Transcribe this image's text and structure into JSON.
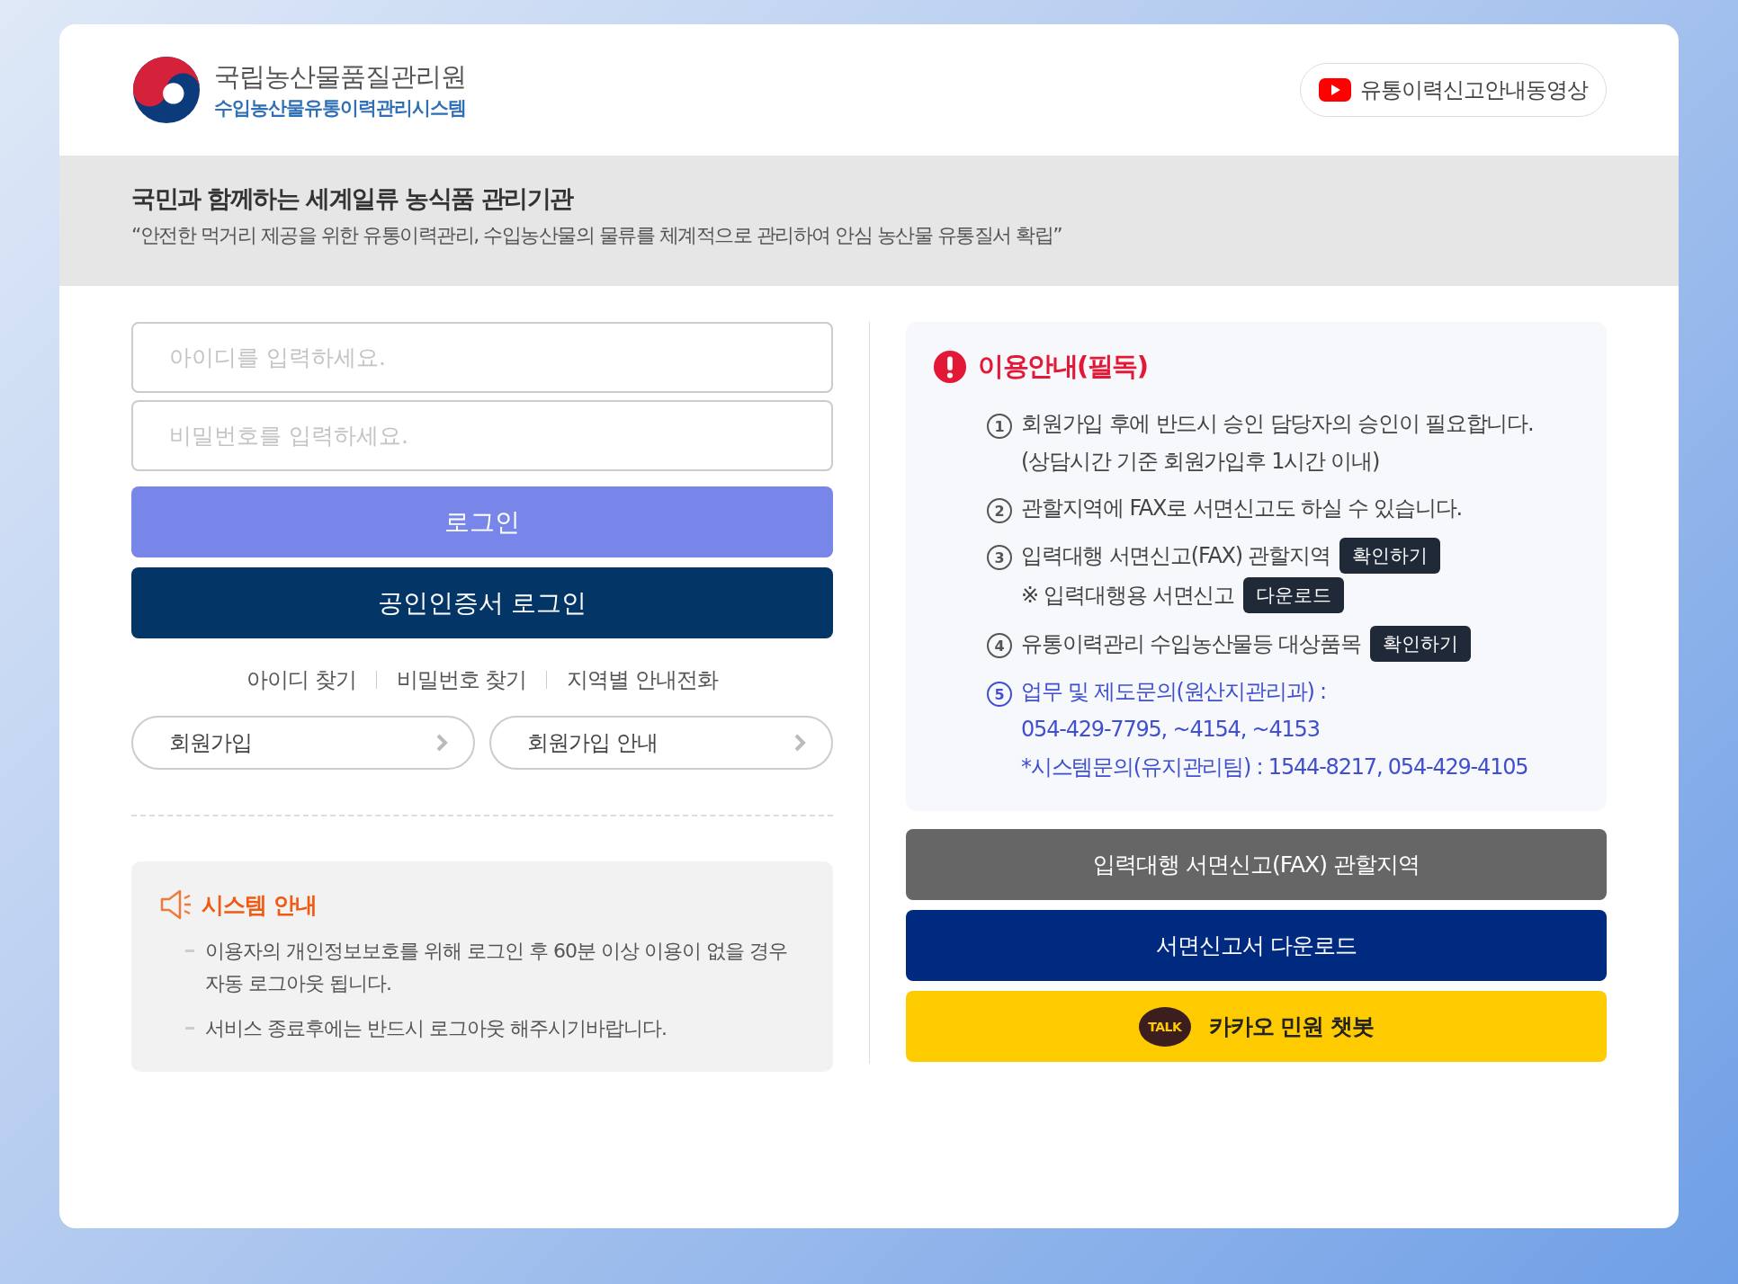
{
  "header": {
    "org_name": "국립농산물품질관리원",
    "system_name": "수입농산물유통이력관리시스템",
    "video_button": "유통이력신고안내동영상"
  },
  "banner": {
    "title": "국민과 함께하는 세계일류 농식품 관리기관",
    "quote": "“안전한 먹거리 제공을 위한 유통이력관리, 수입농산물의 물류를 체계적으로 관리하여 안심 농산물 유통질서 확립”"
  },
  "login": {
    "id_placeholder": "아이디를 입력하세요.",
    "pw_placeholder": "비밀번호를 입력하세요.",
    "login_button": "로그인",
    "cert_login_button": "공인인증서 로그인",
    "links": [
      "아이디 찾기",
      "비밀번호 찾기",
      "지역별 안내전화"
    ],
    "join_buttons": [
      "회원가입",
      "회원가입 안내"
    ]
  },
  "system_notice": {
    "title": "시스템 안내",
    "items": [
      "이용자의 개인정보보호를 위해 로그인 후 60분 이상 이용이 없을 경우 자동 로그아웃 됩니다.",
      "서비스 종료후에는 반드시 로그아웃 해주시기바랍니다."
    ]
  },
  "usage_guide": {
    "title": "이용안내(필독)",
    "items": [
      {
        "number": "1",
        "kind": "normal",
        "lines": [
          {
            "text": "회원가입 후에 반드시 승인 담당자의 승인이 필요합니다."
          },
          {
            "text": "(상담시간 기준 회원가입후 1시간 이내)"
          }
        ]
      },
      {
        "number": "2",
        "kind": "normal",
        "lines": [
          {
            "text": "관할지역에 FAX로 서면신고도 하실 수 있습니다."
          }
        ]
      },
      {
        "number": "3",
        "kind": "normal",
        "lines": [
          {
            "text": "입력대행 서면신고(FAX) 관할지역",
            "button": "확인하기"
          },
          {
            "text": "※ 입력대행용 서면신고",
            "button": "다운로드"
          }
        ]
      },
      {
        "number": "4",
        "kind": "normal",
        "lines": [
          {
            "text": "유통이력관리 수입농산물등 대상품목",
            "button": "확인하기"
          }
        ]
      },
      {
        "number": "5",
        "kind": "contact",
        "lines": [
          {
            "text": "업무 및 제도문의(원산지관리과) :"
          },
          {
            "text": "054-429-7795, ~4154, ~4153"
          },
          {
            "text": "*시스템문의(유지관리팀) : 1544-8217,  054-429-4105"
          }
        ]
      }
    ]
  },
  "action_buttons": [
    {
      "kind": "gray",
      "label": "입력대행 서면신고(FAX) 관할지역"
    },
    {
      "kind": "navy",
      "label": "서면신고서 다운로드"
    },
    {
      "kind": "kakao",
      "label": "카카오 민원 챗봇",
      "icon_text": "TALK"
    }
  ]
}
